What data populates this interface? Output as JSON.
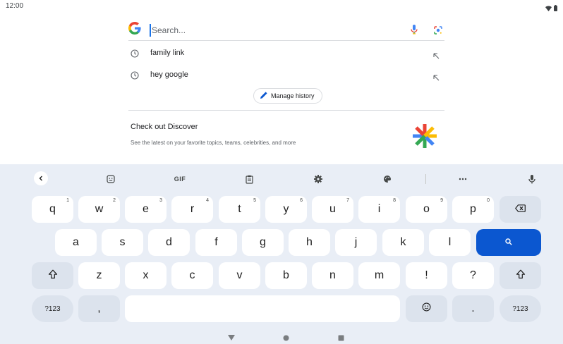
{
  "status_bar": {
    "time": "12:00",
    "icons": [
      "wifi-icon",
      "battery-icon"
    ]
  },
  "search": {
    "placeholder": "Search...",
    "value": "",
    "suggestions": [
      {
        "label": "family link",
        "icon": "clock-icon"
      },
      {
        "label": "hey google",
        "icon": "clock-icon"
      }
    ],
    "manage_history_label": "Manage history",
    "discover": {
      "title": "Check out Discover",
      "subtitle": "See the latest on your favorite topics, teams, celebrities, and more"
    }
  },
  "colors": {
    "accent": "#0b57d0",
    "keyboard_bg": "#e9eef6",
    "key_bg": "#ffffff",
    "key_dark_bg": "#dce3ed"
  },
  "keyboard": {
    "toolbar": {
      "gif_label": "GIF",
      "icons": [
        "back-icon",
        "sticker-icon",
        "gif-icon",
        "clipboard-icon",
        "settings-icon",
        "palette-icon",
        "more-icon",
        "mic-icon"
      ]
    },
    "row1": [
      {
        "label": "q",
        "hint": "1"
      },
      {
        "label": "w",
        "hint": "2"
      },
      {
        "label": "e",
        "hint": "3"
      },
      {
        "label": "r",
        "hint": "4"
      },
      {
        "label": "t",
        "hint": "5"
      },
      {
        "label": "y",
        "hint": "6"
      },
      {
        "label": "u",
        "hint": "7"
      },
      {
        "label": "i",
        "hint": "8"
      },
      {
        "label": "o",
        "hint": "9"
      },
      {
        "label": "p",
        "hint": "0"
      }
    ],
    "row2": [
      "a",
      "s",
      "d",
      "f",
      "g",
      "h",
      "j",
      "k",
      "l"
    ],
    "row3": [
      "z",
      "x",
      "c",
      "v",
      "b",
      "n",
      "m",
      "!",
      "?"
    ],
    "symbols_label": "?123",
    "comma_label": ",",
    "period_label": "."
  },
  "nav": {
    "icons": [
      "back-triangle-icon",
      "home-circle-icon",
      "recents-square-icon"
    ]
  }
}
